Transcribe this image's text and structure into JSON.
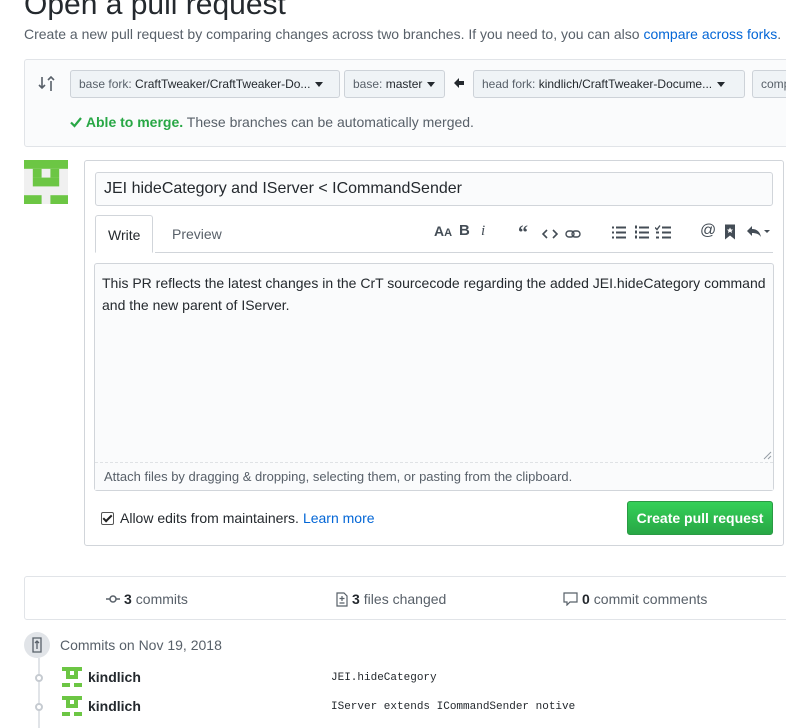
{
  "header": {
    "title": "Open a pull request",
    "description": "Create a new pull request by comparing changes across two branches. If you need to, you can also",
    "compare_link": "compare across forks",
    "description_end": "."
  },
  "range": {
    "base_fork_label": "base fork:",
    "base_fork_value": "CraftTweaker/CraftTweaker-Do...",
    "base_label": "base:",
    "base_value": "master",
    "head_fork_label": "head fork:",
    "head_fork_value": "kindlich/CraftTweaker-Docume...",
    "compare_partial": "comp",
    "merge_ok": "Able to merge.",
    "merge_text": "These branches can be automatically merged."
  },
  "form": {
    "title_value": "JEI hideCategory and IServer < ICommandSender",
    "tab_write": "Write",
    "tab_preview": "Preview",
    "toolbar": {
      "header": "AA",
      "bold": "B",
      "italic": "i",
      "quote": "“",
      "code": "<>",
      "link": "link",
      "bullets": "list",
      "numbered": "numbered-list",
      "tasks": "task-list",
      "mention": "@",
      "reference": "bookmark",
      "reply": "reply"
    },
    "body_text": "This PR reflects the latest changes in the CrT sourcecode regarding the added JEI.hideCategory command and the new parent of IServer.",
    "attach_hint": "Attach files by dragging & dropping, selecting them, or pasting from the clipboard.",
    "allow_edits_label": "Allow edits from maintainers.",
    "learn_more": "Learn more",
    "allow_edits_checked": true,
    "create_button": "Create pull request"
  },
  "stats": {
    "commits_count": "3",
    "commits_label": "commits",
    "files_count": "3",
    "files_label": "files changed",
    "comments_count": "0",
    "comments_label": "commit comments"
  },
  "commits": {
    "date_header": "Commits on Nov 19, 2018",
    "items": [
      {
        "author": "kindlich",
        "message": "JEI.hideCategory"
      },
      {
        "author": "kindlich",
        "message": "IServer extends ICommandSender notive"
      }
    ]
  },
  "colors": {
    "accent_link": "#0366d6",
    "success": "#28a745",
    "avatar_green": "#6cc644"
  }
}
